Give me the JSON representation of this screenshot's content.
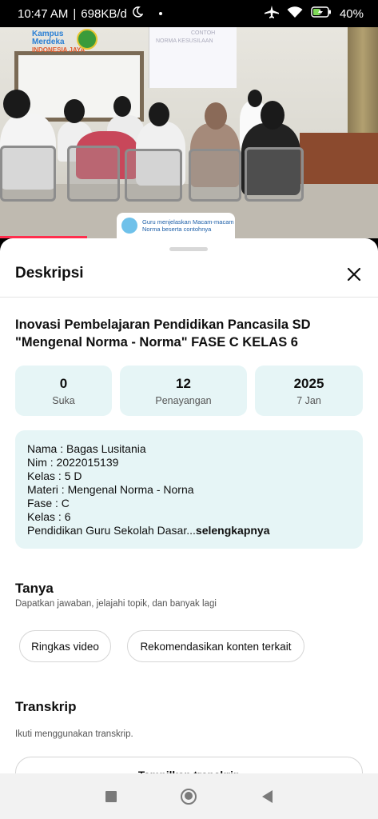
{
  "status_bar": {
    "time": "10:47 AM",
    "speed": "698KB/d",
    "battery": "40%",
    "icons": [
      "moon-icon",
      "airplane-icon",
      "wifi-icon",
      "battery-icon"
    ]
  },
  "video": {
    "logo_text": "Kampus",
    "logo_text2": "Merdeka",
    "logo_sub": "INDONESIA JAYA",
    "projection_text1": "NORMA KESUSILAAN",
    "projection_text2": "CONTOH",
    "caption_line1": "Guru menjelaskan Macam-macam",
    "caption_line2": "Norma beserta contohnya",
    "progress": 0.23
  },
  "sheet": {
    "title": "Deskripsi",
    "video_title": "Inovasi Pembelajaran Pendidikan Pancasila SD \"Mengenal Norma - Norma\" FASE C KELAS 6",
    "stats": [
      {
        "value": "0",
        "label": "Suka"
      },
      {
        "value": "12",
        "label": "Penayangan"
      },
      {
        "value": "2025",
        "label": "7 Jan"
      }
    ],
    "description_lines": [
      "Nama : Bagas Lusitania",
      "Nim : 2022015139",
      "Kelas : 5 D",
      "Materi : Mengenal Norma - Norna",
      "Fase : C",
      "Kelas : 6",
      "Pendidikan Guru Sekolah Dasar..."
    ],
    "more_label": "selengkapnya",
    "ask_title": "Tanya",
    "ask_subtitle": "Dapatkan jawaban, jelajahi topik, dan banyak lagi",
    "chips": [
      "Ringkas video",
      "Rekomendasikan konten terkait"
    ],
    "transcript_title": "Transkrip",
    "transcript_subtitle": "Ikuti menggunakan transkrip.",
    "transcript_button": "Tampilkan transkrip"
  },
  "navbar": {
    "buttons": [
      "recent-apps-icon",
      "home-icon",
      "back-icon"
    ]
  }
}
